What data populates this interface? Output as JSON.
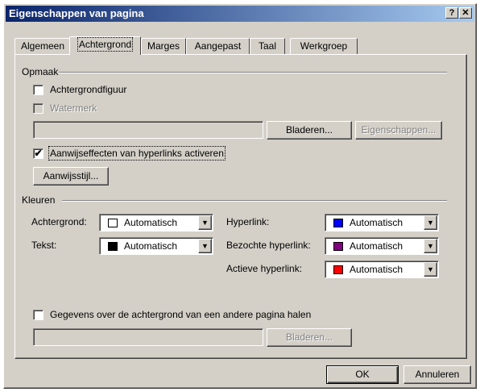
{
  "window": {
    "title": "Eigenschappen van pagina",
    "help_button": "?",
    "close_button": "✕"
  },
  "tabs": [
    {
      "label": "Algemeen",
      "active": false
    },
    {
      "label": "Achtergrond",
      "active": true
    },
    {
      "label": "Marges",
      "active": false
    },
    {
      "label": "Aangepast",
      "active": false
    },
    {
      "label": "Taal",
      "active": false
    },
    {
      "label": "Werkgroep",
      "active": false
    }
  ],
  "formatting": {
    "group_label": "Opmaak",
    "background_picture": {
      "label": "Achtergrondfiguur",
      "checked": false
    },
    "watermark": {
      "label": "Watermerk",
      "checked": false,
      "enabled": false
    },
    "file_value": "",
    "browse_label": "Bladeren...",
    "properties_label": "Eigenschappen...",
    "hover_effects": {
      "label": "Aanwijseffecten van hyperlinks activeren",
      "checked": true,
      "check_glyph": "✔"
    },
    "hover_style_label": "Aanwijsstijl..."
  },
  "colors": {
    "group_label": "Kleuren",
    "background": {
      "label": "Achtergrond:",
      "value": "Automatisch",
      "swatch": "#ffffff"
    },
    "text": {
      "label": "Tekst:",
      "value": "Automatisch",
      "swatch": "#000000"
    },
    "hyperlink": {
      "label": "Hyperlink:",
      "value": "Automatisch",
      "swatch": "#0000ff"
    },
    "visited": {
      "label": "Bezochte hyperlink:",
      "value": "Automatisch",
      "swatch": "#800080"
    },
    "active": {
      "label": "Actieve hyperlink:",
      "value": "Automatisch",
      "swatch": "#ff0000"
    }
  },
  "other_page": {
    "label": "Gegevens over de achtergrond van een andere pagina halen",
    "checked": false,
    "file_value": "",
    "browse_label": "Bladeren..."
  },
  "footer": {
    "ok_label": "OK",
    "cancel_label": "Annuleren"
  },
  "theme": {
    "title_gradient_start": "#0a246a",
    "title_gradient_end": "#a6caf0",
    "face": "#d4d0c8"
  }
}
